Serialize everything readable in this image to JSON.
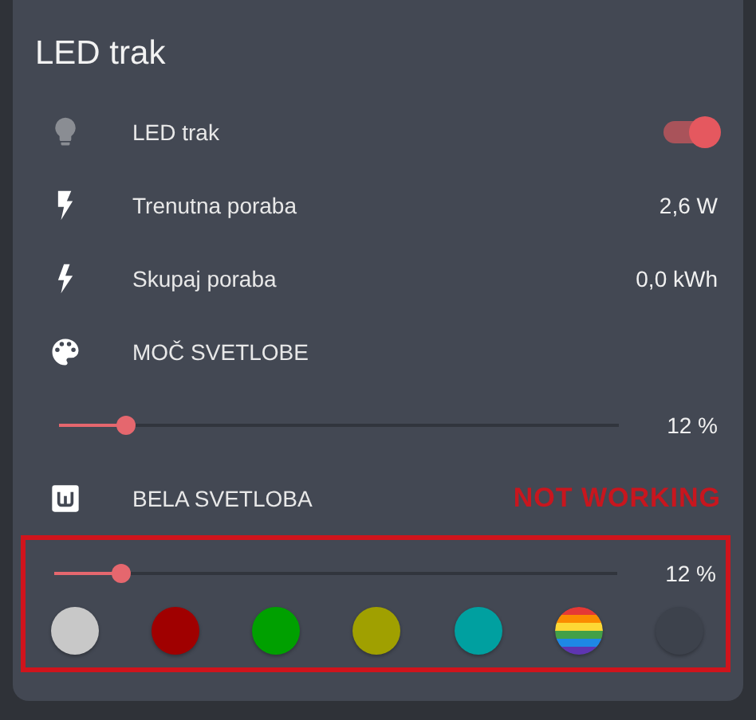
{
  "card": {
    "title": "LED trak"
  },
  "light": {
    "name": "LED trak",
    "on": true
  },
  "sensors": [
    {
      "name": "Trenutna poraba",
      "value": "2,6 W"
    },
    {
      "name": "Skupaj poraba",
      "value": "0,0 kWh"
    }
  ],
  "power_section": {
    "heading": "MOČ SVETLOBE",
    "level": 0.12,
    "reading": "12 %"
  },
  "white_section": {
    "heading": "BELA SVETLOBA",
    "level": 0.12,
    "reading": "12 %"
  },
  "annotation": {
    "text": "NOT WORKING"
  },
  "swatches": [
    {
      "kind": "solid",
      "color": "#c8c8c8"
    },
    {
      "kind": "solid",
      "color": "#a00000"
    },
    {
      "kind": "solid",
      "color": "#00a000"
    },
    {
      "kind": "solid",
      "color": "#a0a000"
    },
    {
      "kind": "solid",
      "color": "#00a0a0"
    },
    {
      "kind": "rainbow"
    },
    {
      "kind": "solid",
      "color": "#3d424c"
    }
  ]
}
